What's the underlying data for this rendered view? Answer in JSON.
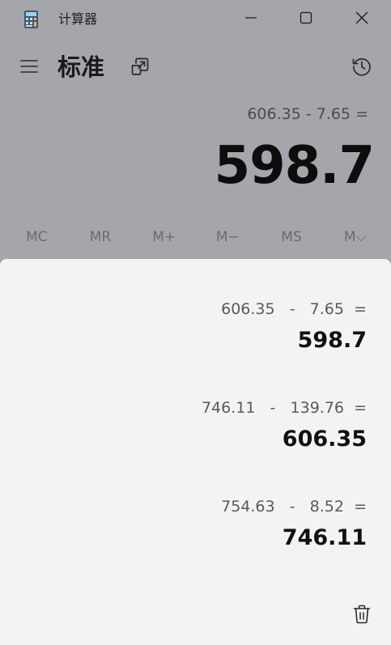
{
  "window": {
    "title": "计算器",
    "icon": "calculator-app-icon",
    "controls": [
      "minimize-icon",
      "maximize-icon",
      "close-icon"
    ]
  },
  "header": {
    "mode": "标准",
    "menu_icon": "hamburger-icon",
    "keep_on_top_icon": "keep-on-top-icon",
    "history_icon": "history-icon"
  },
  "display": {
    "expression": "606.35 - 7.65 =",
    "result": "598.7"
  },
  "memory": {
    "keys": [
      "MC",
      "MR",
      "M+",
      "M−",
      "MS",
      "M⌵"
    ]
  },
  "history": {
    "items": [
      {
        "expression": "606.35   -   7.65  =",
        "result": "598.7"
      },
      {
        "expression": "746.11   -   139.76  =",
        "result": "606.35"
      },
      {
        "expression": "754.63   -   8.52  =",
        "result": "746.11"
      }
    ],
    "clear_icon": "trash-icon"
  },
  "colors": {
    "window_background": "#a5a6ac",
    "panel_background": "#f3f3f3"
  }
}
